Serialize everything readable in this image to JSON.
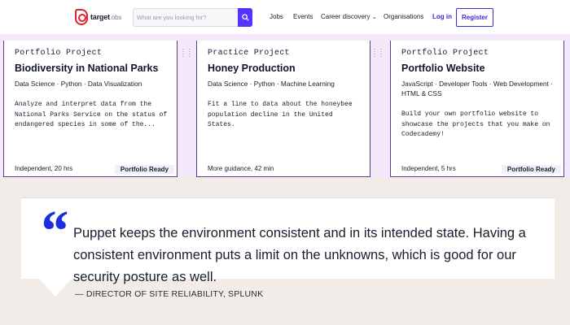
{
  "header": {
    "logo": {
      "brand": "target",
      "suffix": ".obs"
    },
    "search_placeholder": "What are you looking for?",
    "nav": {
      "jobs": "Jobs",
      "events": "Events",
      "career_discovery": "Career discovery",
      "organisations": "Organisations",
      "login": "Log in",
      "register": "Register"
    }
  },
  "cards": [
    {
      "kind": "Portfolio Project",
      "title": "Biodiversity in National Parks",
      "tags": "Data Science · Python · Data Visualization",
      "description": "Analyze and interpret data from the National Parks Service on the status of endangered species in some of the...",
      "meta": "Independent, 20 hrs",
      "badge": "Portfolio Ready"
    },
    {
      "kind": "Practice Project",
      "title": "Honey Production",
      "tags": "Data Science · Python · Machine Learning",
      "description": "Fit a line to data about the honeybee population decline in the United States.",
      "meta": "More guidance, 42 min",
      "badge": ""
    },
    {
      "kind": "Portfolio Project",
      "title": "Portfolio Website",
      "tags": "JavaScript · Developer Tools · Web Development · HTML & CSS",
      "description": "Build your own portfolio website to showcase the projects that you make on Codecademy!",
      "meta": "Independent, 5 hrs",
      "badge": "Portfolio Ready"
    }
  ],
  "quote": {
    "mark": "“",
    "text": "Puppet keeps the environment consistent and in its intended state. Having a consistent environment puts a limit on the unknowns, which is good for our security posture as well.",
    "attribution": "— DIRECTOR OF SITE RELIABILITY, SPLUNK"
  },
  "colors": {
    "brand_red": "#e0222a",
    "accent_purple": "#3b2bd6",
    "search_button": "#5533ff",
    "quote_mark": "#1a2ee0",
    "band_background": "#f4e8fb"
  }
}
